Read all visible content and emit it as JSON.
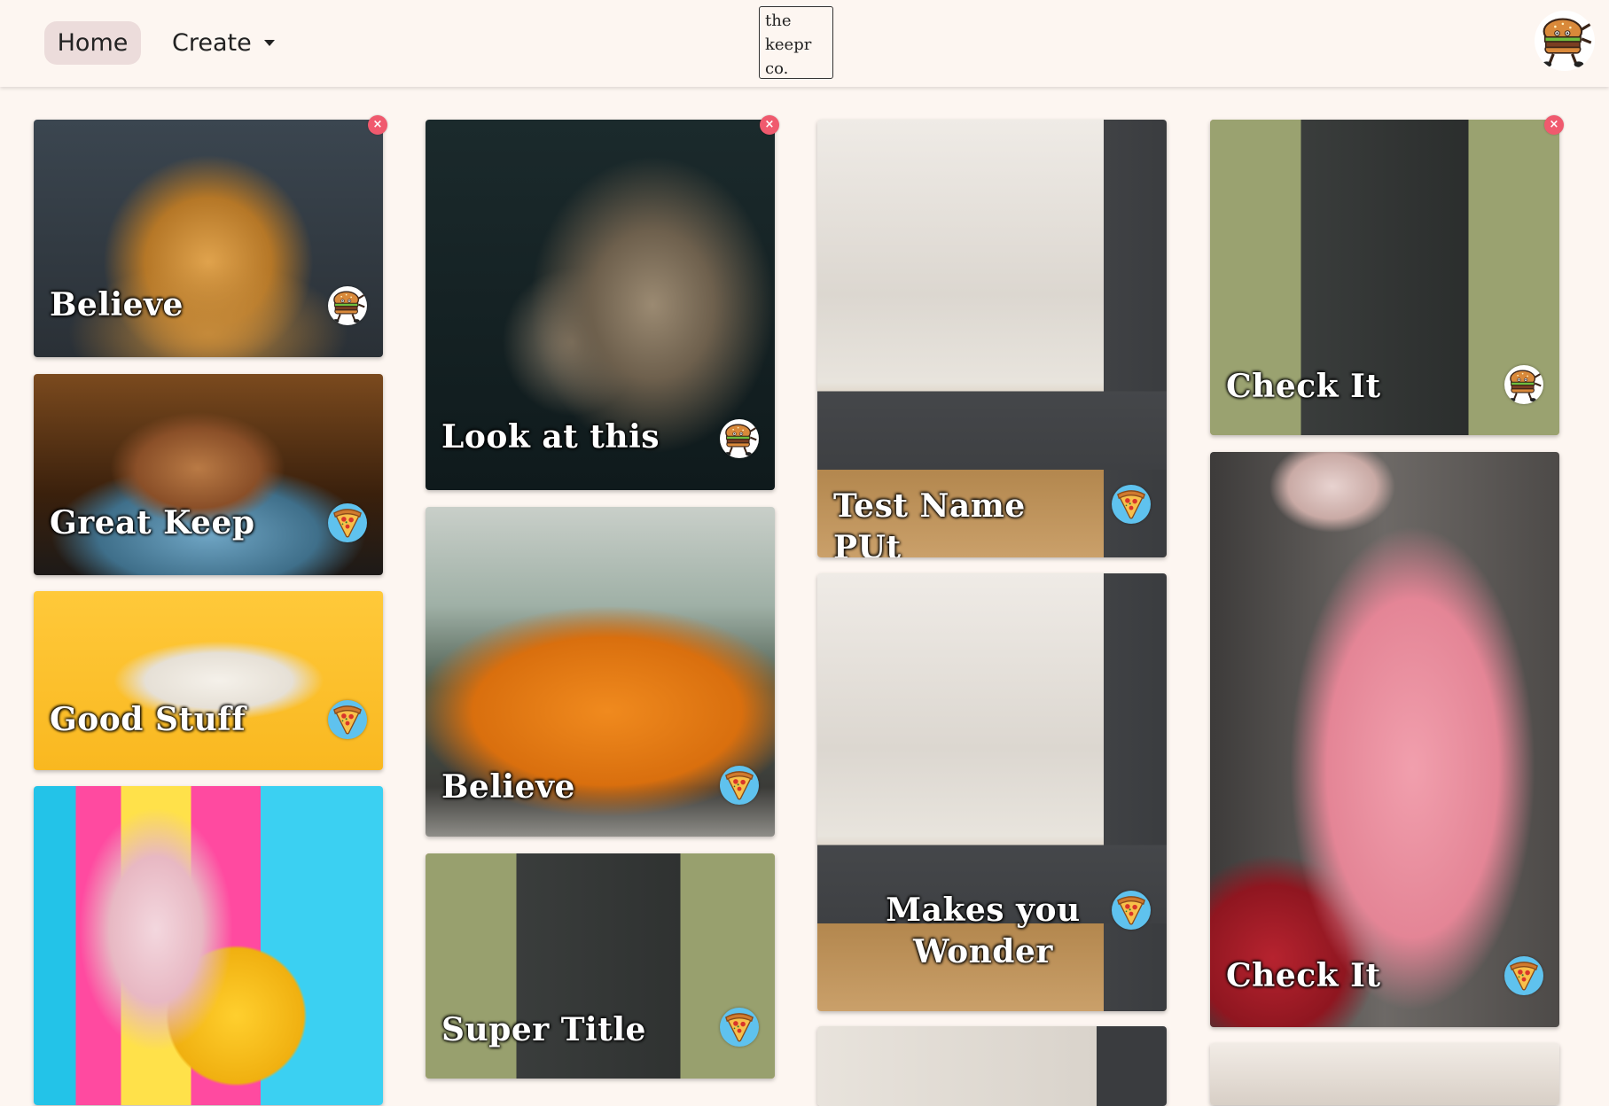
{
  "nav": {
    "home_label": "Home",
    "create_label": "Create",
    "logo_lines": [
      "the",
      "keepr",
      "co."
    ],
    "user_avatar_icon": "burger-mascot-icon"
  },
  "keeps": [
    {
      "title": "Believe",
      "creator_icon": "burger-mascot-icon",
      "deletable": true,
      "delete_symbol": "×",
      "image": "pancake stack"
    },
    {
      "title": "Great Keep",
      "creator_icon": "pizza-slice-icon",
      "deletable": false,
      "image": "coffee cup"
    },
    {
      "title": "Good Stuff",
      "creator_icon": "pizza-slice-icon",
      "deletable": false,
      "image": "white car"
    },
    {
      "title": "",
      "creator_icon": "",
      "deletable": false,
      "image": "ice cream balloon"
    },
    {
      "title": "Look at this",
      "creator_icon": "burger-mascot-icon",
      "deletable": true,
      "delete_symbol": "×",
      "image": "wolf"
    },
    {
      "title": "Believe",
      "creator_icon": "pizza-slice-icon",
      "deletable": false,
      "image": "orange beetle"
    },
    {
      "title": "Super Title",
      "creator_icon": "pizza-slice-icon",
      "deletable": false,
      "image": "game boy"
    },
    {
      "title": "Test Name PUt",
      "creator_icon": "pizza-slice-icon",
      "deletable": false,
      "image": "kitchen"
    },
    {
      "title": "Makes you Wonder",
      "creator_icon": "pizza-slice-icon",
      "deletable": false,
      "image": "kitchen"
    },
    {
      "title": "",
      "creator_icon": "",
      "deletable": false,
      "image": "kitchen"
    },
    {
      "title": "Check It",
      "creator_icon": "burger-mascot-icon",
      "deletable": true,
      "delete_symbol": "×",
      "image": "game boy"
    },
    {
      "title": "Check It",
      "creator_icon": "pizza-slice-icon",
      "deletable": false,
      "image": "pink watch"
    },
    {
      "title": "",
      "creator_icon": "",
      "deletable": false,
      "image": "landscape"
    }
  ],
  "colors": {
    "page_bg": "#fdf6f1",
    "home_pill": "#ecdcdb",
    "delete_button": "#f05a6e",
    "pizza_badge_bg": "#5fc2ee"
  }
}
